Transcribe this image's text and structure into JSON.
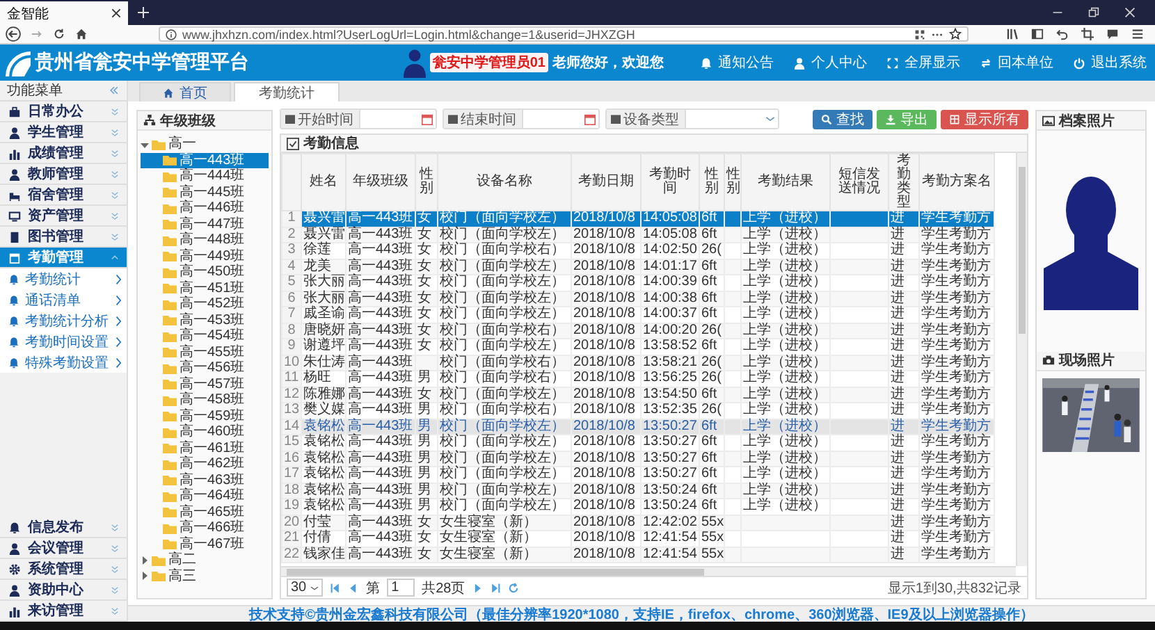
{
  "browser": {
    "tab_title": "金智能",
    "url": "www.jhxhzn.com/index.html?UserLogUrl=Login.html&change=1&userid=JHXZGH"
  },
  "header": {
    "title": "贵州省瓮安中学管理平台",
    "user_name": "瓮安中学管理员01",
    "greeting": "老师您好，欢迎您",
    "links": [
      {
        "label": "通知公告"
      },
      {
        "label": "个人中心"
      },
      {
        "label": "全屏显示"
      },
      {
        "label": "回本单位"
      },
      {
        "label": "退出系统"
      }
    ]
  },
  "sidebar": {
    "title": "功能菜单",
    "items": [
      {
        "label": "日常办公",
        "selected": false,
        "expanded": false
      },
      {
        "label": "学生管理",
        "selected": false,
        "expanded": false
      },
      {
        "label": "成绩管理",
        "selected": false,
        "expanded": false
      },
      {
        "label": "教师管理",
        "selected": false,
        "expanded": false
      },
      {
        "label": "宿舍管理",
        "selected": false,
        "expanded": false
      },
      {
        "label": "资产管理",
        "selected": false,
        "expanded": false
      },
      {
        "label": "图书管理",
        "selected": false,
        "expanded": false
      },
      {
        "label": "考勤管理",
        "selected": true,
        "expanded": true,
        "children": [
          {
            "label": "考勤统计",
            "selected": false
          },
          {
            "label": "通话清单",
            "selected": false
          },
          {
            "label": "考勤统计分析",
            "selected": false
          },
          {
            "label": "考勤时间设置",
            "selected": false
          },
          {
            "label": "特殊考勤设置",
            "selected": false
          }
        ]
      }
    ],
    "bottom_items": [
      {
        "label": "信息发布",
        "selected": false,
        "expanded": false
      },
      {
        "label": "会议管理",
        "selected": false,
        "expanded": false
      },
      {
        "label": "系统管理",
        "selected": false,
        "expanded": false
      },
      {
        "label": "资助中心",
        "selected": false,
        "expanded": false
      },
      {
        "label": "来访管理",
        "selected": false,
        "expanded": false
      }
    ]
  },
  "tabs": [
    {
      "label": "首页",
      "selected": false
    },
    {
      "label": "考勤统计",
      "selected": true
    }
  ],
  "tree": {
    "title": "年级班级",
    "items": [
      {
        "label": "高一",
        "expanded": true,
        "selected": false,
        "children": [
          {
            "label": "高一443班",
            "selected": true
          },
          {
            "label": "高一444班",
            "selected": false
          },
          {
            "label": "高一445班",
            "selected": false
          },
          {
            "label": "高一446班",
            "selected": false
          },
          {
            "label": "高一447班",
            "selected": false
          },
          {
            "label": "高一448班",
            "selected": false
          },
          {
            "label": "高一449班",
            "selected": false
          },
          {
            "label": "高一450班",
            "selected": false
          },
          {
            "label": "高一451班",
            "selected": false
          },
          {
            "label": "高一452班",
            "selected": false
          },
          {
            "label": "高一453班",
            "selected": false
          },
          {
            "label": "高一454班",
            "selected": false
          },
          {
            "label": "高一455班",
            "selected": false
          },
          {
            "label": "高一456班",
            "selected": false
          },
          {
            "label": "高一457班",
            "selected": false
          },
          {
            "label": "高一458班",
            "selected": false
          },
          {
            "label": "高一459班",
            "selected": false
          },
          {
            "label": "高一460班",
            "selected": false
          },
          {
            "label": "高一461班",
            "selected": false
          },
          {
            "label": "高一462班",
            "selected": false
          },
          {
            "label": "高一463班",
            "selected": false
          },
          {
            "label": "高一464班",
            "selected": false
          },
          {
            "label": "高一465班",
            "selected": false
          },
          {
            "label": "高一466班",
            "selected": false
          },
          {
            "label": "高一467班",
            "selected": false
          }
        ]
      },
      {
        "label": "高二",
        "expanded": false,
        "selected": false
      },
      {
        "label": "高三",
        "expanded": false,
        "selected": false
      }
    ]
  },
  "filters": [
    {
      "label": "开始时间",
      "kind": "date"
    },
    {
      "label": "结束时间",
      "kind": "date"
    },
    {
      "label": "设备类型",
      "kind": "select"
    }
  ],
  "buttons": [
    {
      "label": "查找",
      "color": "#337ab7"
    },
    {
      "label": "导出",
      "color": "#5cb85c"
    },
    {
      "label": "显示所有",
      "color": "#d9534f"
    }
  ],
  "table": {
    "title": "考勤信息",
    "columns": [
      "姓名",
      "年级班级",
      "性别",
      "设备名称",
      "考勤日期",
      "考勤时间",
      "性别",
      "性别",
      "考勤结果",
      "短信发送情况",
      "考勤类型",
      "考勤方案名"
    ],
    "rows": [
      {
        "index": "1",
        "selected": true,
        "hovered": false,
        "cells": [
          "聂兴雷",
          "高一443班",
          "女",
          "校门（面向学校左）",
          "2018/10/8",
          "14:05:08",
          "6ft",
          null,
          "上学（进校）",
          null,
          "进",
          "学生考勤方"
        ]
      },
      {
        "index": "2",
        "selected": false,
        "hovered": false,
        "cells": [
          "聂兴雷",
          "高一443班",
          "女",
          "校门（面向学校左）",
          "2018/10/8",
          "14:05:08",
          "6ft",
          null,
          "上学（进校）",
          null,
          "进",
          "学生考勤方"
        ]
      },
      {
        "index": "3",
        "selected": false,
        "hovered": false,
        "cells": [
          "徐莲",
          "高一443班",
          "女",
          "校门（面向学校右）",
          "2018/10/8",
          "14:02:50",
          "26(",
          null,
          "上学（进校）",
          null,
          "进",
          "学生考勤方"
        ]
      },
      {
        "index": "4",
        "selected": false,
        "hovered": false,
        "cells": [
          "龙美",
          "高一443班",
          "女",
          "校门（面向学校左）",
          "2018/10/8",
          "14:01:17",
          "6ft",
          null,
          "上学（进校）",
          null,
          "进",
          "学生考勤方"
        ]
      },
      {
        "index": "5",
        "selected": false,
        "hovered": false,
        "cells": [
          "张大丽",
          "高一443班",
          "女",
          "校门（面向学校左）",
          "2018/10/8",
          "14:00:39",
          "6ft",
          null,
          "上学（进校）",
          null,
          "进",
          "学生考勤方"
        ]
      },
      {
        "index": "6",
        "selected": false,
        "hovered": false,
        "cells": [
          "张大丽",
          "高一443班",
          "女",
          "校门（面向学校左）",
          "2018/10/8",
          "14:00:38",
          "6ft",
          null,
          "上学（进校）",
          null,
          "进",
          "学生考勤方"
        ]
      },
      {
        "index": "7",
        "selected": false,
        "hovered": false,
        "cells": [
          "戚圣谕",
          "高一443班",
          "女",
          "校门（面向学校左）",
          "2018/10/8",
          "14:00:37",
          "6ft",
          null,
          "上学（进校）",
          null,
          "进",
          "学生考勤方"
        ]
      },
      {
        "index": "8",
        "selected": false,
        "hovered": false,
        "cells": [
          "唐晓妍",
          "高一443班",
          "女",
          "校门（面向学校右）",
          "2018/10/8",
          "14:00:20",
          "26(",
          null,
          "上学（进校）",
          null,
          "进",
          "学生考勤方"
        ]
      },
      {
        "index": "9",
        "selected": false,
        "hovered": false,
        "cells": [
          "谢遵坪",
          "高一443班",
          "女",
          "校门（面向学校左）",
          "2018/10/8",
          "13:58:52",
          "6ft",
          null,
          "上学（进校）",
          null,
          "进",
          "学生考勤方"
        ]
      },
      {
        "index": "10",
        "selected": false,
        "hovered": false,
        "cells": [
          "朱仕涛",
          "高一443班",
          null,
          "校门（面向学校右）",
          "2018/10/8",
          "13:58:21",
          "26(",
          null,
          "上学（进校）",
          null,
          "进",
          "学生考勤方"
        ]
      },
      {
        "index": "11",
        "selected": false,
        "hovered": false,
        "cells": [
          "杨旺",
          "高一443班",
          "男",
          "校门（面向学校右）",
          "2018/10/8",
          "13:56:25",
          "26(",
          null,
          "上学（进校）",
          null,
          "进",
          "学生考勤方"
        ]
      },
      {
        "index": "12",
        "selected": false,
        "hovered": false,
        "cells": [
          "陈雅娜",
          "高一443班",
          "女",
          "校门（面向学校左）",
          "2018/10/8",
          "13:54:50",
          "6ft",
          null,
          "上学（进校）",
          null,
          "进",
          "学生考勤方"
        ]
      },
      {
        "index": "13",
        "selected": false,
        "hovered": false,
        "cells": [
          "樊义媒",
          "高一443班",
          "男",
          "校门（面向学校右）",
          "2018/10/8",
          "13:52:35",
          "26(",
          null,
          "上学（进校）",
          null,
          "进",
          "学生考勤方"
        ]
      },
      {
        "index": "14",
        "selected": false,
        "hovered": true,
        "cells": [
          "袁铭松",
          "高一443班",
          "男",
          "校门（面向学校左）",
          "2018/10/8",
          "13:50:27",
          "6ft",
          null,
          "上学（进校）",
          null,
          "进",
          "学生考勤方"
        ]
      },
      {
        "index": "15",
        "selected": false,
        "hovered": false,
        "cells": [
          "袁铭松",
          "高一443班",
          "男",
          "校门（面向学校左）",
          "2018/10/8",
          "13:50:27",
          "6ft",
          null,
          "上学（进校）",
          null,
          "进",
          "学生考勤方"
        ]
      },
      {
        "index": "16",
        "selected": false,
        "hovered": false,
        "cells": [
          "袁铭松",
          "高一443班",
          "男",
          "校门（面向学校左）",
          "2018/10/8",
          "13:50:27",
          "6ft",
          null,
          "上学（进校）",
          null,
          "进",
          "学生考勤方"
        ]
      },
      {
        "index": "17",
        "selected": false,
        "hovered": false,
        "cells": [
          "袁铭松",
          "高一443班",
          "男",
          "校门（面向学校左）",
          "2018/10/8",
          "13:50:27",
          "6ft",
          null,
          "上学（进校）",
          null,
          "进",
          "学生考勤方"
        ]
      },
      {
        "index": "18",
        "selected": false,
        "hovered": false,
        "cells": [
          "袁铭松",
          "高一443班",
          "男",
          "校门（面向学校左）",
          "2018/10/8",
          "13:50:24",
          "6ft",
          null,
          "上学（进校）",
          null,
          "进",
          "学生考勤方"
        ]
      },
      {
        "index": "19",
        "selected": false,
        "hovered": false,
        "cells": [
          "袁铭松",
          "高一443班",
          "男",
          "校门（面向学校左）",
          "2018/10/8",
          "13:50:24",
          "6ft",
          null,
          "上学（进校）",
          null,
          "进",
          "学生考勤方"
        ]
      },
      {
        "index": "20",
        "selected": false,
        "hovered": false,
        "cells": [
          "付莹",
          "高一443班",
          "女",
          "女生寝室（新）",
          "2018/10/8",
          "12:42:02",
          "55x",
          null,
          null,
          null,
          "进",
          "学生考勤方"
        ]
      },
      {
        "index": "21",
        "selected": false,
        "hovered": false,
        "cells": [
          "付倩",
          "高一443班",
          "女",
          "女生寝室（新）",
          "2018/10/8",
          "12:41:54",
          "55x",
          null,
          null,
          null,
          "进",
          "学生考勤方"
        ]
      },
      {
        "index": "22",
        "selected": false,
        "hovered": false,
        "cells": [
          "钱家佳",
          "高一443班",
          "女",
          "女生寝室（新）",
          "2018/10/8",
          "12:41:54",
          "55x",
          null,
          null,
          null,
          "进",
          "学生考勤方"
        ]
      }
    ]
  },
  "pager": {
    "page_size": "30",
    "page_label": "第",
    "page": "1",
    "total_pages": "共28页",
    "summary": "显示1到30,共832记录"
  },
  "photos": {
    "profile_title": "档案照片",
    "scene_title": "现场照片"
  },
  "footer": "技术支持©贵州金宏鑫科技有限公司（最佳分辨率1920*1080，支持IE，firefox、chrome、360浏览器、IE9及以上浏览器操作）"
}
